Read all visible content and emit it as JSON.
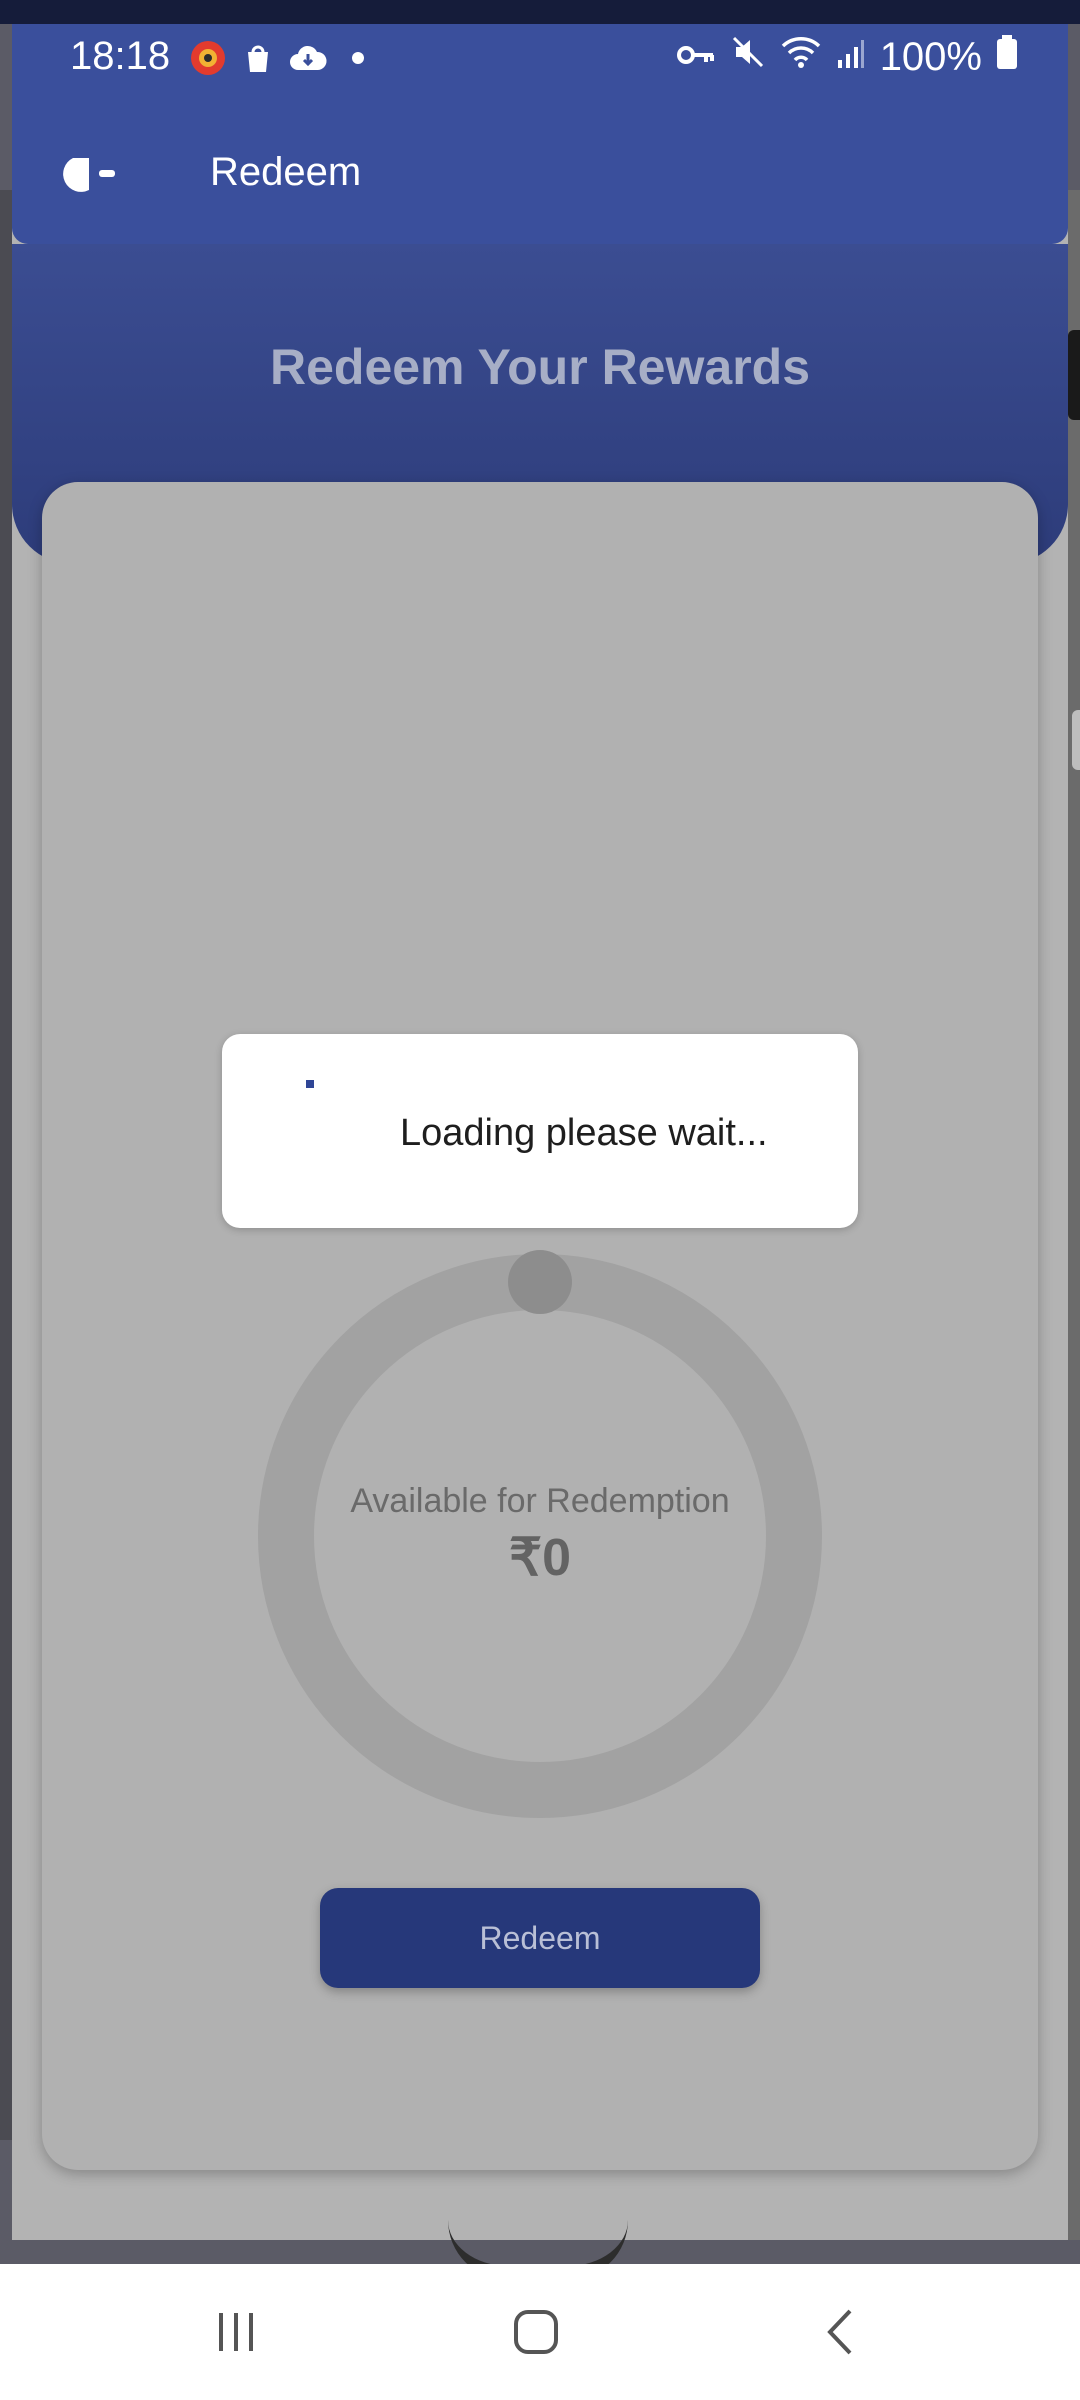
{
  "status_bar": {
    "time": "18:18",
    "battery": "100%",
    "icons": [
      "app-icon",
      "shopping-bag-icon",
      "cloud-icon",
      "dot-icon",
      "vpn-key-icon",
      "mute-icon",
      "wifi-icon",
      "signal-icon",
      "battery-icon"
    ]
  },
  "app_bar": {
    "title": "Redeem",
    "back_icon": "back-icon"
  },
  "banner": {
    "title": "Redeem Your Rewards"
  },
  "balance": {
    "label": "Available for Redemption",
    "amount": "₹0"
  },
  "actions": {
    "redeem_label": "Redeem"
  },
  "dialog": {
    "message": "Loading please wait..."
  },
  "nav": {
    "items": [
      "recent-apps-icon",
      "home-icon",
      "back-icon"
    ]
  },
  "colors": {
    "primary": "#3a4f9c",
    "button": "#26387a"
  }
}
